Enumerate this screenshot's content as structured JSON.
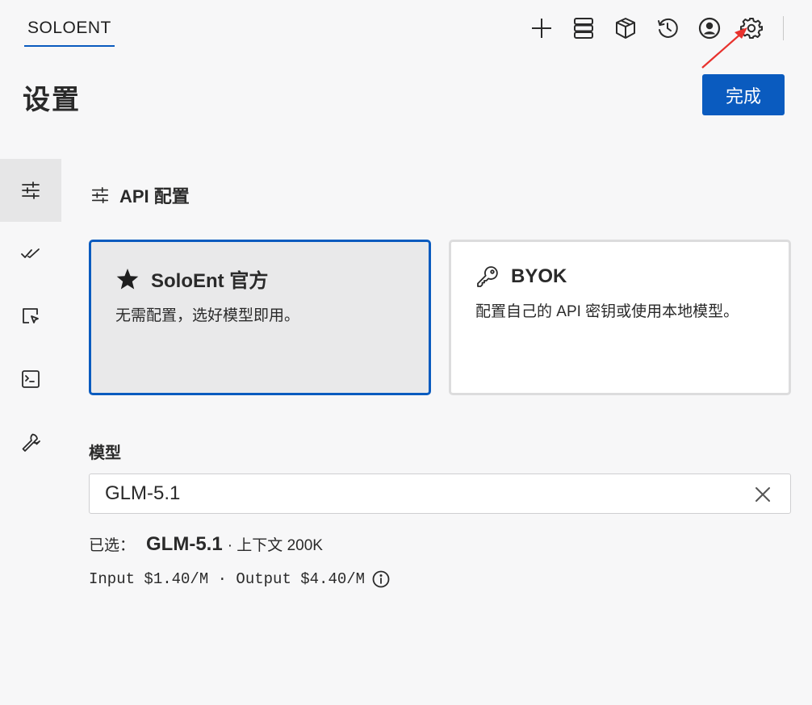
{
  "topbar": {
    "brand_tab": "SOLOENT",
    "icons": [
      "plus-icon",
      "server-icon",
      "cube-icon",
      "history-icon",
      "account-icon",
      "gear-icon"
    ]
  },
  "header": {
    "title": "设置",
    "done_label": "完成"
  },
  "sidebar": {
    "items": [
      {
        "icon": "sliders-icon",
        "active": true
      },
      {
        "icon": "double-check-icon",
        "active": false
      },
      {
        "icon": "cursor-window-icon",
        "active": false
      },
      {
        "icon": "terminal-icon",
        "active": false
      },
      {
        "icon": "wrench-icon",
        "active": false
      }
    ]
  },
  "api_config": {
    "section_title": "API 配置",
    "cards": [
      {
        "icon": "star-icon",
        "title": "SoloEnt 官方",
        "desc": "无需配置，选好模型即用。",
        "selected": true
      },
      {
        "icon": "key-icon",
        "title": "BYOK",
        "desc": "配置自己的 API 密钥或使用本地模型。",
        "selected": false
      }
    ]
  },
  "model": {
    "label": "模型",
    "value": "GLM-5.1",
    "selected_prefix": "已选：",
    "selected_model": "GLM-5.1",
    "context_text": "· 上下文 200K",
    "pricing_text": "Input $1.40/M · Output $4.40/M"
  },
  "colors": {
    "accent": "#0a5bbf",
    "annotation_arrow": "#e8322d"
  }
}
